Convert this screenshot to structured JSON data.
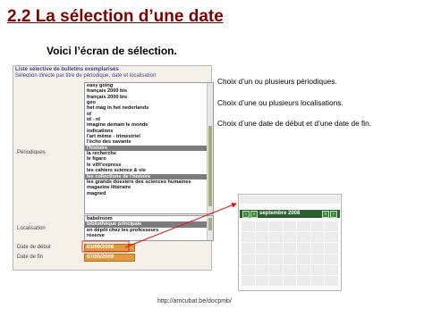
{
  "slide": {
    "title": "2.2 La sélection d’une date",
    "subtitle": "Voici l’écran de sélection.",
    "footer": "http://amcubat.be/docpmb/"
  },
  "form": {
    "heading": "Liste sélective de bulletins exemplarisés",
    "subheading": "Sélection directe par titre de périodique, date et localisation",
    "labels": {
      "periodiques": "Périodiques",
      "localisation": "Localisation",
      "date_debut": "Date de début",
      "date_fin": "Date de fin"
    },
    "periodiques_options": [
      {
        "label": "easy going",
        "selected": false
      },
      {
        "label": "français 2000 bis",
        "selected": false
      },
      {
        "label": "français 2000 bis",
        "selected": false
      },
      {
        "label": "geo",
        "selected": false
      },
      {
        "label": "het mag in het nederlands",
        "selected": false
      },
      {
        "label": "id",
        "selected": false
      },
      {
        "label": "id - nl",
        "selected": false
      },
      {
        "label": "imagine demain le monde",
        "selected": false
      },
      {
        "label": "indications",
        "selected": false
      },
      {
        "label": "l'art même - trimestriel",
        "selected": false
      },
      {
        "label": "l'écho des savants",
        "selected": false
      },
      {
        "label": "l'histoire",
        "selected": true
      },
      {
        "label": "la recherche",
        "selected": false
      },
      {
        "label": "le figaro",
        "selected": false
      },
      {
        "label": "le vif/l'express",
        "selected": false
      },
      {
        "label": "les cahiers science & vie",
        "selected": false
      },
      {
        "label": "les collections de l'histoire",
        "selected": true
      },
      {
        "label": "les grands dossiers des sciences humaines",
        "selected": false
      },
      {
        "label": "magazine littéraire",
        "selected": false
      },
      {
        "label": "magned",
        "selected": false
      }
    ],
    "localisation_options": [
      {
        "label": "babelroom",
        "selected": false
      },
      {
        "label": "bibliothèque principale",
        "selected": true
      },
      {
        "label": "en dépôt chez les professeurs",
        "selected": false
      },
      {
        "label": "réserve",
        "selected": false
      }
    ],
    "date_debut": "01/09/2008",
    "date_fin": "07/05/2009"
  },
  "callouts": [
    "Choix d’un ou plusieurs périodiques.",
    "Choix d’une ou plusieurs localisations.",
    "Choix d’une date de début et d’une date de fin."
  ],
  "calendar": {
    "month_label": "septembre 2008",
    "prev_icon": "chevron-left-icon",
    "next_icon": "chevron-right-icon"
  },
  "colors": {
    "title": "#800000",
    "selection": "#7c7c7c",
    "date_field": "#e39a3d",
    "calendar_header": "#2d5e2d",
    "arrows": "#e01010"
  }
}
